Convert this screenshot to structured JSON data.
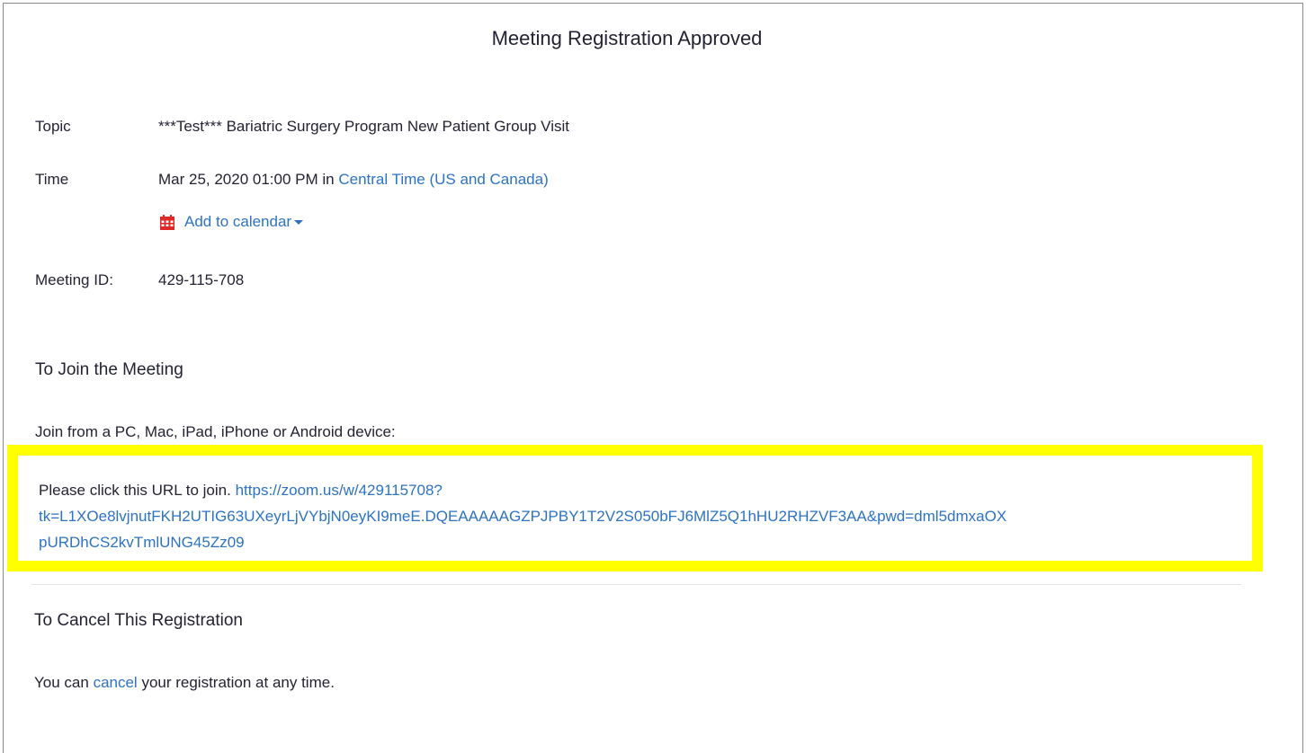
{
  "page": {
    "title": "Meeting Registration Approved"
  },
  "details": {
    "topic_label": "Topic",
    "topic_value": "***Test*** Bariatric Surgery Program New Patient Group Visit",
    "time_label": "Time",
    "time_value": "Mar 25, 2020 01:00 PM in",
    "timezone_link": "Central Time (US and Canada)",
    "add_to_calendar": "Add to calendar",
    "meeting_id_label": "Meeting ID:",
    "meeting_id_value": "429-115-708"
  },
  "join": {
    "heading": "To Join the Meeting",
    "devices_text": "Join from a PC, Mac, iPad, iPhone or Android device:",
    "click_prompt": "Please click this URL to join.",
    "url_line1": "https://zoom.us/w/429115708?",
    "url_line2": "tk=L1XOe8lvjnutFKH2UTIG63UXeyrLjVYbjN0eyKI9meE.DQEAAAAAGZPJPBY1T2V2S050bFJ6MlZ5Q1hHU2RHZVF3AA&pwd=dml5dmxaOX",
    "url_line3": "pURDhCS2kvTmlUNG45Zz09",
    "highlight_color": "#ffff00"
  },
  "cancel": {
    "heading": "To Cancel This Registration",
    "text_before": "You can",
    "link": "cancel",
    "text_after": "your registration at any time."
  },
  "colors": {
    "link": "#2d73c2",
    "text": "#232333",
    "calendar_icon": "#e02828"
  },
  "icons": {
    "calendar": "calendar-icon",
    "dropdown": "caret-down-icon"
  }
}
